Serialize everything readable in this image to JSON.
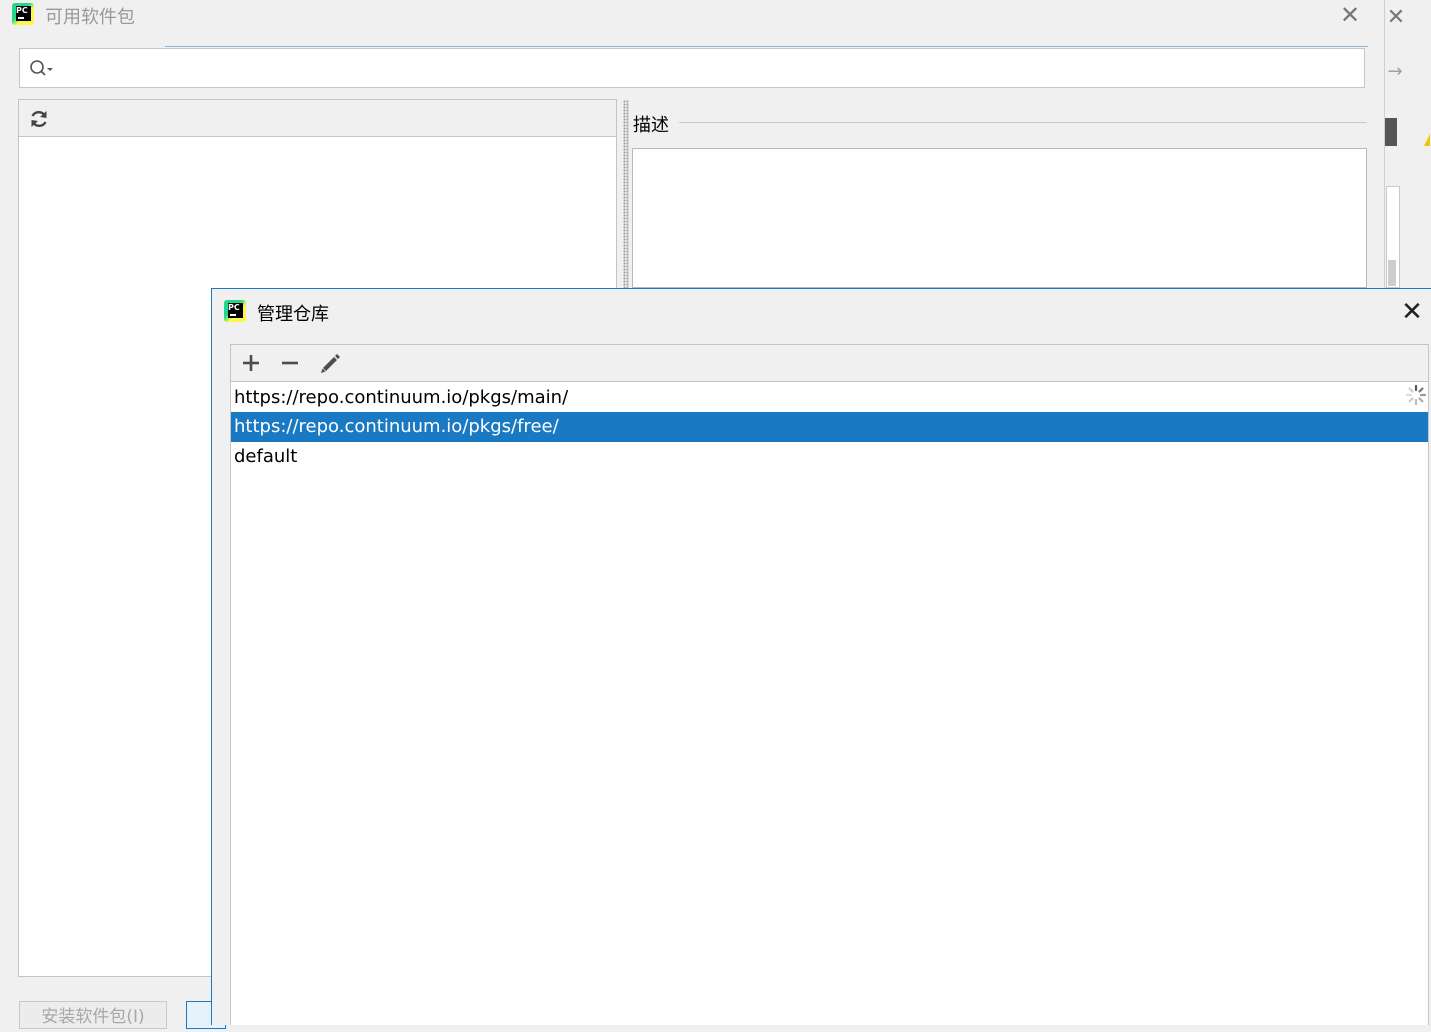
{
  "main_window": {
    "title": "可用软件包",
    "title_icon": "pycharm-logo-icon",
    "close_icon": "close-icon",
    "search": {
      "value": "",
      "icon": "search-icon"
    },
    "packages_panel": {
      "refresh_icon": "refresh-icon",
      "items": []
    },
    "description": {
      "label": "描述",
      "text": ""
    },
    "install_button_label": "安装软件包(I)"
  },
  "dialog": {
    "title": "管理仓库",
    "title_icon": "pycharm-logo-icon",
    "close_icon": "close-icon",
    "toolbar": {
      "add_icon": "plus-icon",
      "remove_icon": "minus-icon",
      "edit_icon": "pencil-icon"
    },
    "repositories": [
      {
        "url": "https://repo.continuum.io/pkgs/main/",
        "selected": false
      },
      {
        "url": "https://repo.continuum.io/pkgs/free/",
        "selected": true
      },
      {
        "url": "default",
        "selected": false
      }
    ],
    "loading_icon": "spinner-icon"
  },
  "colors": {
    "selection": "#1979c3",
    "dialog_border": "#1a7ac4"
  }
}
